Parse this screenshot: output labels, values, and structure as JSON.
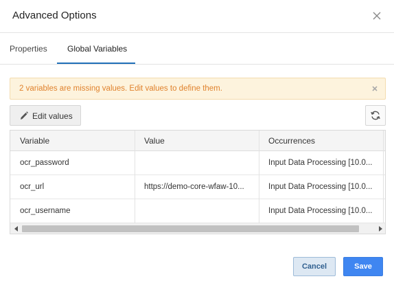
{
  "dialog": {
    "title": "Advanced Options"
  },
  "tabs": [
    {
      "label": "Properties",
      "active": false
    },
    {
      "label": "Global Variables",
      "active": true
    }
  ],
  "alert": {
    "message": "2 variables are missing values. Edit values to define them."
  },
  "toolbar": {
    "edit_label": "Edit values",
    "edit_icon": "pencil-icon",
    "refresh_icon": "refresh-icon"
  },
  "table": {
    "columns": [
      "Variable",
      "Value",
      "Occurrences"
    ],
    "rows": [
      {
        "variable": "ocr_password",
        "value": "",
        "occurrences": "Input Data Processing [10.0..."
      },
      {
        "variable": "ocr_url",
        "value": "https://demo-core-wfaw-10...",
        "occurrences": "Input Data Processing [10.0..."
      },
      {
        "variable": "ocr_username",
        "value": "",
        "occurrences": "Input Data Processing [10.0..."
      }
    ]
  },
  "footer": {
    "cancel_label": "Cancel",
    "save_label": "Save"
  },
  "colors": {
    "accent": "#1f6fb8",
    "save_button": "#3f86f1",
    "alert_bg": "#fdf3dd",
    "alert_text": "#e0822d"
  }
}
